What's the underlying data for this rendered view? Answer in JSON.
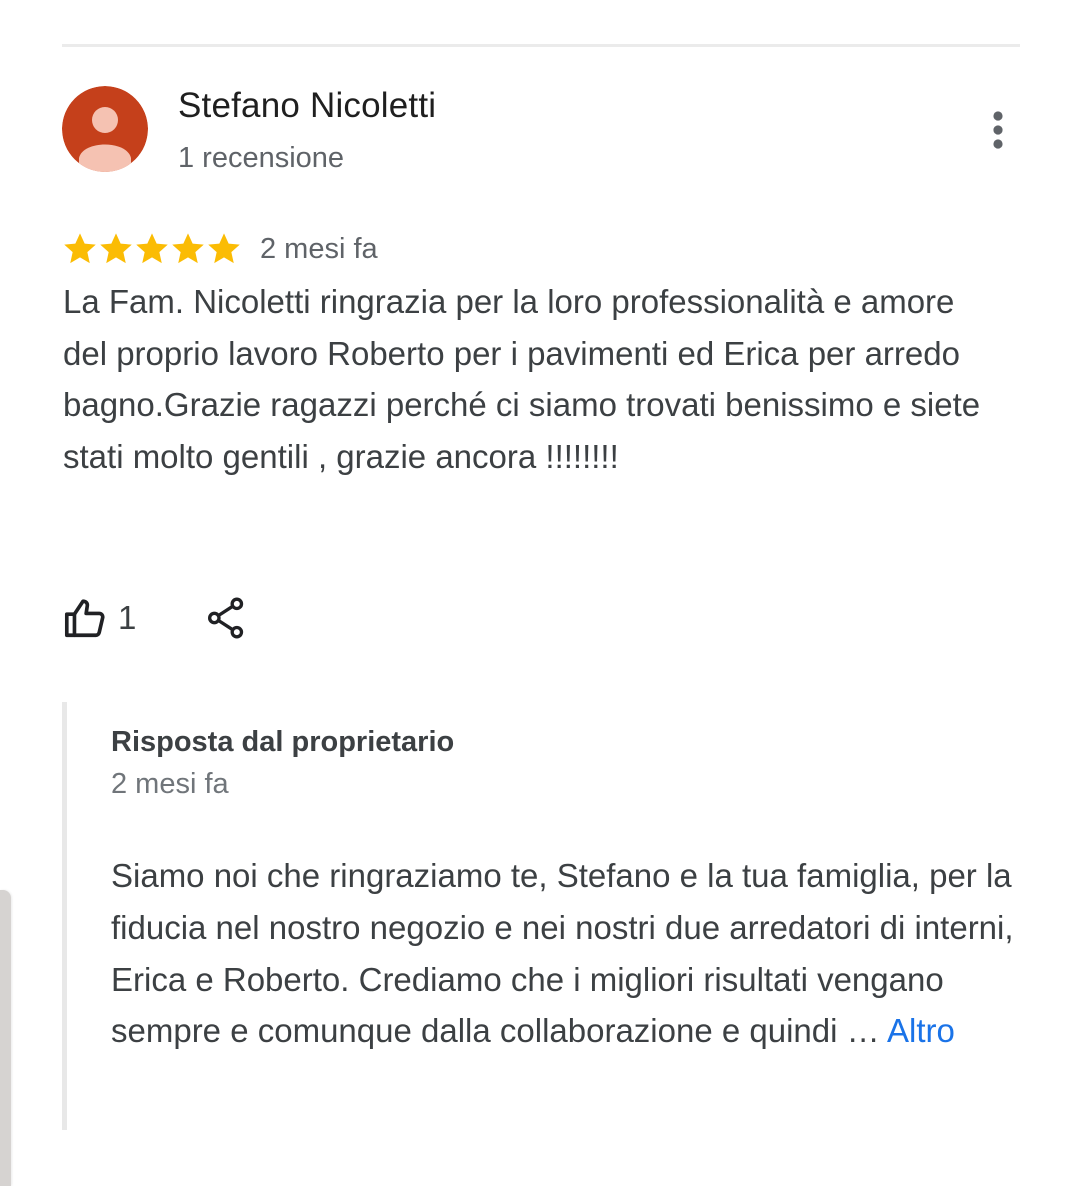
{
  "reviewer": {
    "name": "Stefano Nicoletti",
    "review_count": "1 recensione",
    "avatar_icon": "person-avatar-icon",
    "avatar_color": "#c5401b"
  },
  "review": {
    "rating": 5,
    "max_rating": 5,
    "star_color": "#fbbc04",
    "date": "2 mesi fa",
    "text": "La Fam. Nicoletti ringrazia per la loro professionalità e amore del proprio lavoro Roberto per i pavimenti ed Erica per arredo bagno.Grazie ragazzi perché ci siamo trovati benissimo e siete stati molto gentili , grazie ancora !!!!!!!!",
    "like_count": "1",
    "like_icon": "thumbs-up-icon",
    "share_icon": "share-icon",
    "menu_icon": "more-vert-icon"
  },
  "owner_reply": {
    "title": "Risposta dal proprietario",
    "date": "2 mesi fa",
    "text": "Siamo noi che ringraziamo te, Stefano e la tua famiglia, per la fiducia nel nostro negozio e nei nostri due arredatori di interni, Erica e Roberto. Crediamo che i migliori risultati vengano sempre e comunque dalla collaborazione e quindi …",
    "more_label": "Altro",
    "link_color": "#1a73e8"
  }
}
